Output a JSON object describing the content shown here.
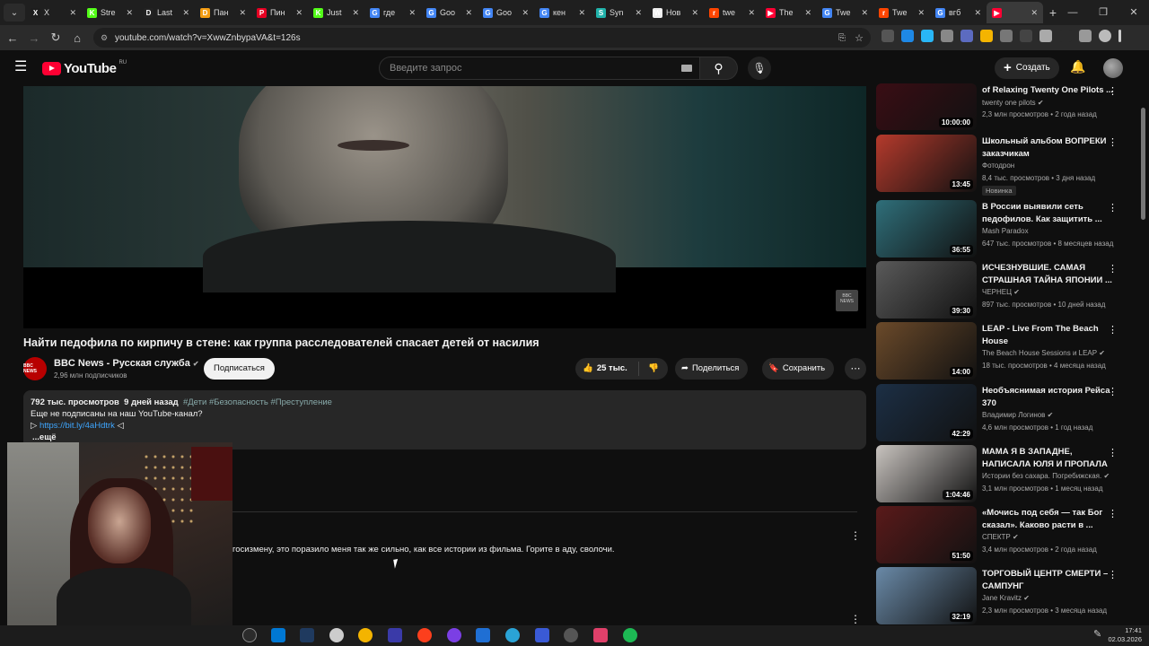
{
  "browser": {
    "tabs": [
      {
        "label": "X",
        "color": "#1d1d1d",
        "glyph": "X"
      },
      {
        "label": "Stre",
        "color": "#53fc18",
        "glyph": "K"
      },
      {
        "label": "Last",
        "color": "#222",
        "glyph": "D"
      },
      {
        "label": "Пан",
        "color": "#f39c12",
        "glyph": "D"
      },
      {
        "label": "Пин",
        "color": "#e60023",
        "glyph": "P"
      },
      {
        "label": "Just",
        "color": "#53fc18",
        "glyph": "K"
      },
      {
        "label": "где",
        "color": "#4285f4",
        "glyph": "G"
      },
      {
        "label": "Goo",
        "color": "#4285f4",
        "glyph": "G"
      },
      {
        "label": "Goo",
        "color": "#4285f4",
        "glyph": "G"
      },
      {
        "label": "кен",
        "color": "#4285f4",
        "glyph": "G"
      },
      {
        "label": "Syn",
        "color": "#20b2aa",
        "glyph": "S"
      },
      {
        "label": "Нов",
        "color": "#eee",
        "glyph": "W"
      },
      {
        "label": "twe",
        "color": "#ff4500",
        "glyph": "r"
      },
      {
        "label": "The",
        "color": "#ff0033",
        "glyph": "▶"
      },
      {
        "label": "Twe",
        "color": "#4285f4",
        "glyph": "G"
      },
      {
        "label": "Twe",
        "color": "#ff4500",
        "glyph": "r"
      },
      {
        "label": "вгб",
        "color": "#4285f4",
        "glyph": "G"
      },
      {
        "label": "",
        "color": "#ff0033",
        "glyph": "▶"
      }
    ],
    "url": "youtube.com/watch?v=XwwZnbypaVA&t=126s"
  },
  "header": {
    "logo": "YouTube",
    "region": "RU",
    "search_placeholder": "Введите запрос",
    "create_label": "Создать"
  },
  "video": {
    "title": "Найти педофила по кирпичу в стене: как группа расследователей спасает детей от насилия",
    "channel": "BBC News - Русская служба",
    "channel_avatar": "BBC NEWS",
    "subscribers": "2,96 млн подписчиков",
    "subscribe_label": "Подписаться",
    "likes": "25 тыс.",
    "share_label": "Поделиться",
    "save_label": "Сохранить",
    "watermark": "BBC NEWS"
  },
  "description": {
    "views": "792 тыс. просмотров",
    "age": "9 дней назад",
    "tags": "#Дети #Безопасность #Преступление",
    "line2": "Еще не подписаны на наш YouTube-канал?",
    "line3_prefix": "▷",
    "link": "https://bit.ly/4aHdtrk",
    "line3_suffix": "◁",
    "more": "...ещё"
  },
  "comment": {
    "text": "госизмену, это поразило меня так же сильно, как все истории из фильма. Горите в аду, сволочи."
  },
  "sidebar": [
    {
      "title": "of Relaxing Twenty One Pilots ...",
      "channel": "twenty one pilots",
      "verified": true,
      "stats": "2,3 млн просмотров • 2 года назад",
      "duration": "10:00:00",
      "thumb": "#3a0d14"
    },
    {
      "title": "Школьный альбом ВОПРЕКИ заказчикам",
      "channel": "Фотодрон",
      "verified": false,
      "stats": "8,4 тыс. просмотров • 3 дня назад",
      "duration": "13:45",
      "badge": "Новинка",
      "thumb": "#b53a2c"
    },
    {
      "title": "В России выявили сеть педофилов. Как защитить ...",
      "channel": "Mash Paradox",
      "verified": false,
      "stats": "647 тыс. просмотров • 8 месяцев назад",
      "duration": "36:55",
      "thumb": "#2f6f7a"
    },
    {
      "title": "ИСЧЕЗНУВШИЕ. САМАЯ СТРАШНАЯ ТАЙНА ЯПОНИИ ...",
      "channel": "ЧЕРНЕЦ",
      "verified": true,
      "stats": "897 тыс. просмотров • 10 дней назад",
      "duration": "39:30",
      "thumb": "#5a5a5a"
    },
    {
      "title": "LEAP - Live From The Beach House",
      "channel": "The Beach House Sessions и LEAP",
      "verified": true,
      "stats": "18 тыс. просмотров • 4 месяца назад",
      "duration": "14:00",
      "thumb": "#6b4a2a"
    },
    {
      "title": "Необъяснимая история Рейса 370",
      "channel": "Владимир Логинов",
      "verified": true,
      "stats": "4,6 млн просмотров • 1 год назад",
      "duration": "42:29",
      "thumb": "#1c2f45"
    },
    {
      "title": "МАМА Я В ЗАПАДНЕ, НАПИСАЛА ЮЛЯ И ПРОПАЛА",
      "channel": "Истории без сахара. Погребижская.",
      "verified": true,
      "stats": "3,1 млн просмотров • 1 месяц назад",
      "duration": "1:04:46",
      "thumb": "#c9c4c0"
    },
    {
      "title": "«Мочись под себя — так Бог сказал». Каково расти в ...",
      "channel": "СПЕКТР",
      "verified": true,
      "stats": "3,4 млн просмотров • 2 года назад",
      "duration": "51:50",
      "thumb": "#5a1a1a"
    },
    {
      "title": "ТОРГОВЫЙ ЦЕНТР СМЕРТИ – САМПУНГ",
      "channel": "Jane Kravitz",
      "verified": true,
      "stats": "2,3 млн просмотров • 3 месяца назад",
      "duration": "32:19",
      "thumb": "#6a8aa8"
    }
  ],
  "taskbar": {
    "time": "17:41",
    "date": "02.03.2026"
  }
}
